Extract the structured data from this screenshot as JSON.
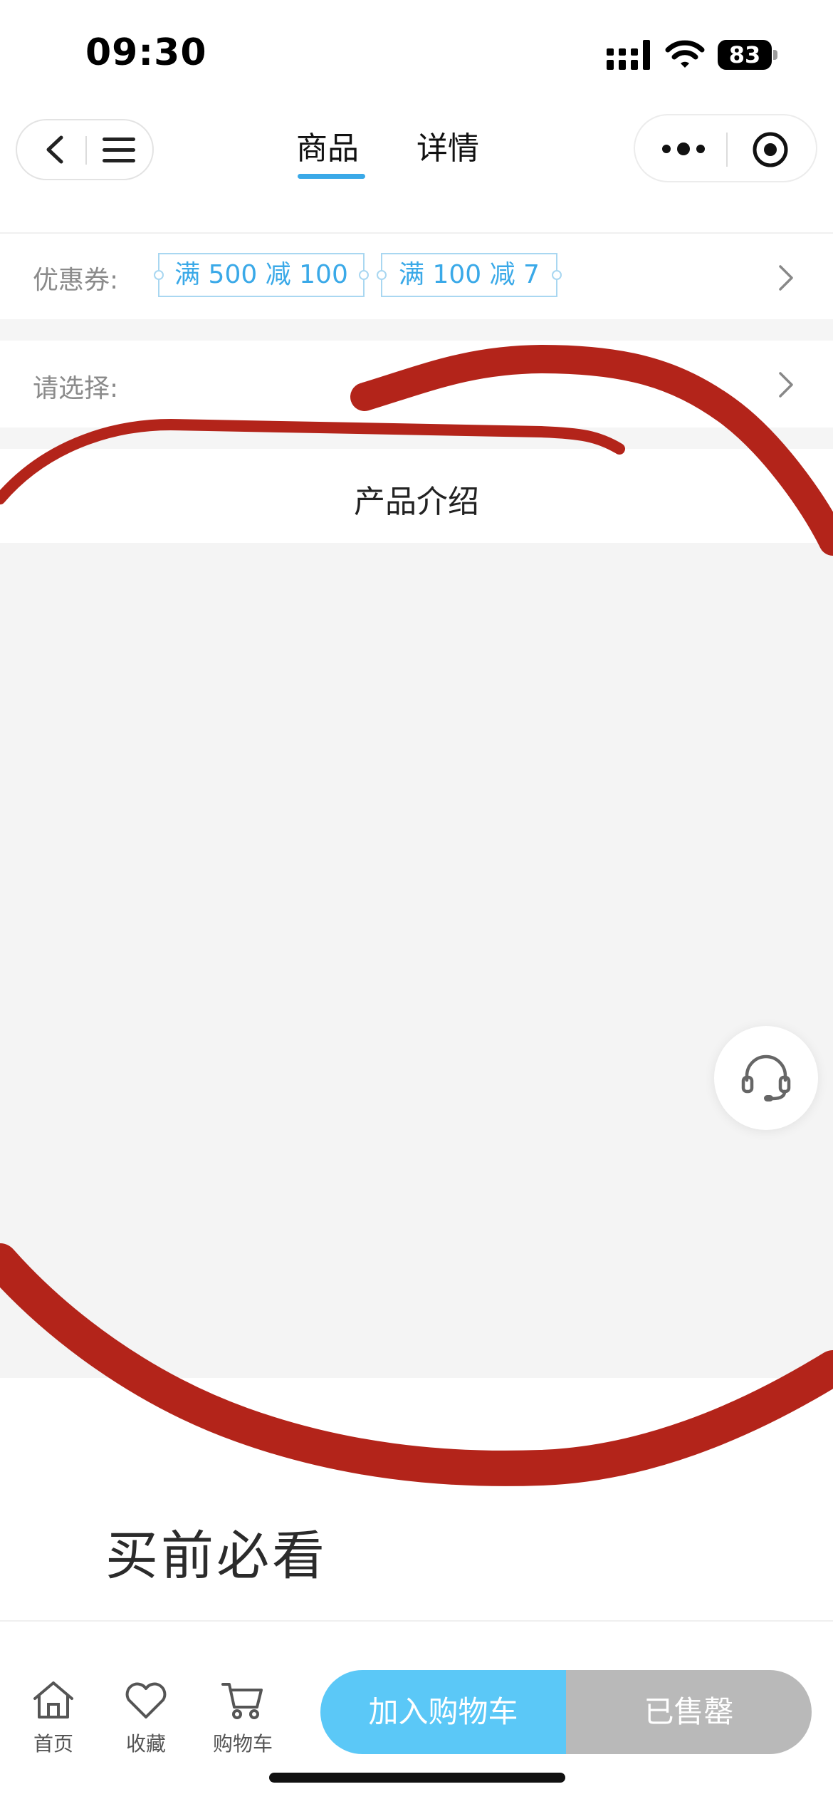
{
  "status_bar": {
    "time": "09:30",
    "battery": "83"
  },
  "nav": {
    "tabs": [
      {
        "label": "商品",
        "active": true
      },
      {
        "label": "详情",
        "active": false
      }
    ]
  },
  "coupon_row": {
    "label": "优惠券:",
    "coupons": [
      "满 500 减 100",
      "满 100 减 7"
    ]
  },
  "select_row": {
    "label": "请选择:"
  },
  "intro": {
    "title": "产品介绍"
  },
  "must_read": {
    "title": "买前必看"
  },
  "bottom_bar": {
    "home_label": "首页",
    "favorite_label": "收藏",
    "cart_label": "购物车",
    "add_to_cart_label": "加入购物车",
    "sold_out_label": "已售罄"
  },
  "colors": {
    "accent": "#3aa9e8",
    "add_to_cart": "#5bc8f7",
    "sold_out": "#b9b9b9",
    "annotation": "#b3241a"
  },
  "icons": [
    "back-icon",
    "menu-icon",
    "more-icon",
    "target-icon",
    "chevron-right-icon",
    "headset-icon",
    "home-icon",
    "heart-icon",
    "cart-icon"
  ]
}
